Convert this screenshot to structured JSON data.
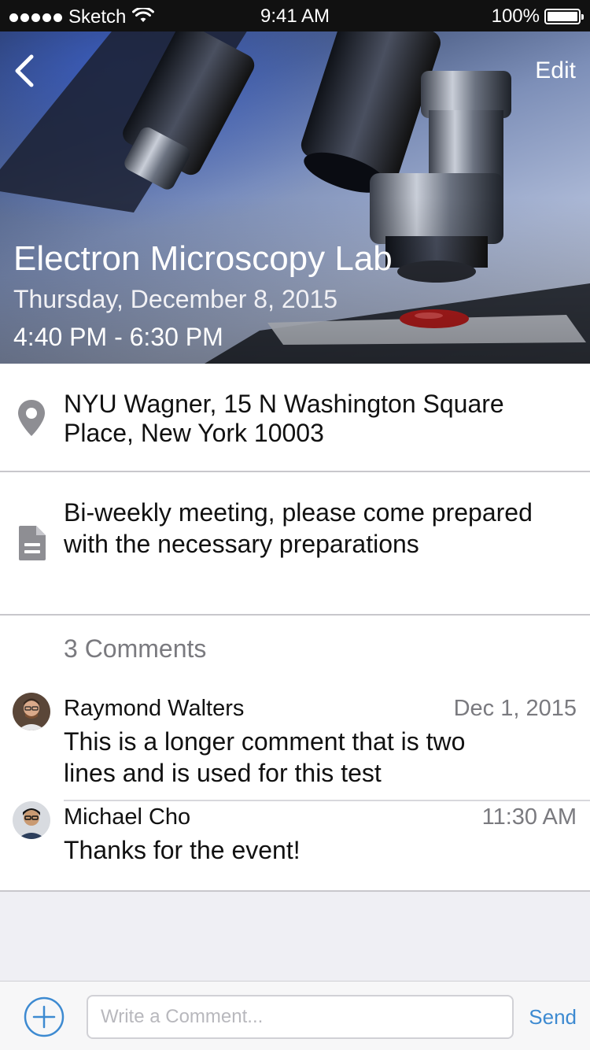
{
  "status_bar": {
    "carrier": "Sketch",
    "time": "9:41 AM",
    "battery": "100%",
    "battery_level": 1.0
  },
  "header": {
    "back_icon": "chevron-left-icon",
    "edit_label": "Edit",
    "title": "Electron Microscopy Lab",
    "date": "Thursday, December 8, 2015",
    "time_range": "4:40 PM - 6:30 PM"
  },
  "location": {
    "icon": "location-pin-icon",
    "line1": "NYU Wagner, 15 N Washington Square",
    "line2": "Place, New York 10003"
  },
  "description": {
    "icon": "document-icon",
    "line1": "Bi-weekly meeting, please come prepared",
    "line2": "with the necessary preparations"
  },
  "comments": {
    "count_label": "3 Comments",
    "items": [
      {
        "author": "Raymond Walters",
        "date": "Dec 1, 2015",
        "line1": "This is a longer comment that is two",
        "line2": "lines and is used for this test"
      },
      {
        "author": "Michael Cho",
        "date": "11:30 AM",
        "line1": "Thanks for the event!"
      }
    ]
  },
  "composer": {
    "add_icon": "plus-circle-icon",
    "placeholder": "Write a Comment...",
    "value": "",
    "send_label": "Send"
  },
  "colors": {
    "accent": "#3d8ad1",
    "icon_gray": "#8e8e93",
    "secondary_text": "#7a7a7f"
  }
}
